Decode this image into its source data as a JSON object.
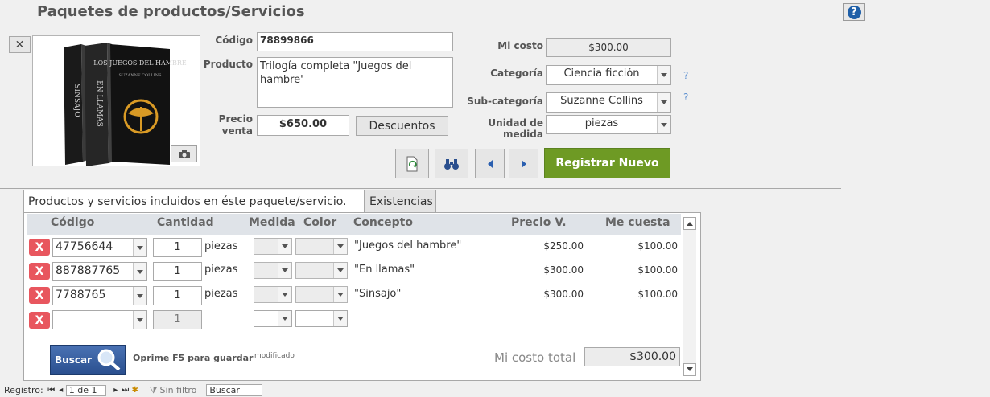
{
  "header": {
    "title": "Paquetes de productos/Servicios",
    "help_label": "?"
  },
  "image": {
    "close_label": "✕",
    "camera_icon": "camera-icon",
    "books": [
      {
        "spine_text": "SINSAJO",
        "color": "#1c1c1c"
      },
      {
        "spine_text": "EN LLAMAS",
        "color": "#2a2a2a"
      },
      {
        "cover_title": "LOS JUEGOS DEL HAMBRE",
        "cover_author": "SUZANNE COLLINS",
        "color": "#141414",
        "emblem_color": "#d99a25"
      }
    ]
  },
  "form": {
    "codigo_label": "Código",
    "codigo_value": "78899866",
    "producto_label": "Producto",
    "producto_value": "Trilogía completa \"Juegos del hambre'",
    "precio_label_1": "Precio",
    "precio_label_2": "venta",
    "precio_value": "$650.00",
    "descuentos_label": "Descuentos",
    "mi_costo_label": "Mi costo",
    "mi_costo_value": "$300.00",
    "categoria_label": "Categoría",
    "categoria_value": "Ciencia ficción",
    "subcategoria_label": "Sub-categoría",
    "subcategoria_value": "Suzanne Collins",
    "unidad_label": "Unidad de medida",
    "unidad_value": "piezas",
    "help_q": "?"
  },
  "toolbar": {
    "refresh_icon": "refresh-doc-icon",
    "find_icon": "binoculars-icon",
    "prev_icon": "triangle-left-icon",
    "next_icon": "triangle-right-icon",
    "registrar_label": "Registrar Nuevo",
    "accent": "#6e9a24"
  },
  "tabs": [
    {
      "label": "Productos y servicios incluidos en éste paquete/servicio."
    },
    {
      "label": "Existencias"
    }
  ],
  "table": {
    "headers": {
      "codigo": "Código",
      "cantidad": "Cantidad",
      "medida": "Medida",
      "color": "Color",
      "concepto": "Concepto",
      "precio": "Precio V.",
      "cuesta": "Me cuesta"
    },
    "delete_label": "X",
    "rows": [
      {
        "codigo": "47756644",
        "cantidad": "1",
        "unidad": "piezas",
        "concepto": "\"Juegos del hambre\"",
        "precio": "$250.00",
        "cuesta": "$100.00"
      },
      {
        "codigo": "887887765",
        "cantidad": "1",
        "unidad": "piezas",
        "concepto": "\"En llamas\"",
        "precio": "$300.00",
        "cuesta": "$100.00"
      },
      {
        "codigo": "7788765",
        "cantidad": "1",
        "unidad": "piezas",
        "concepto": "\"Sinsajo\"",
        "precio": "$300.00",
        "cuesta": "$100.00"
      },
      {
        "codigo": "",
        "cantidad": "1"
      }
    ]
  },
  "footer": {
    "buscar_label": "Buscar",
    "save_hint": "Oprime F5 para guardar",
    "modified_label": "modificado",
    "total_label": "Mi costo total",
    "total_value": "$300.00"
  },
  "statusbar": {
    "registro_label": "Registro:",
    "position": "1 de 1",
    "filter_label": "Sin filtro",
    "search_label": "Buscar"
  }
}
